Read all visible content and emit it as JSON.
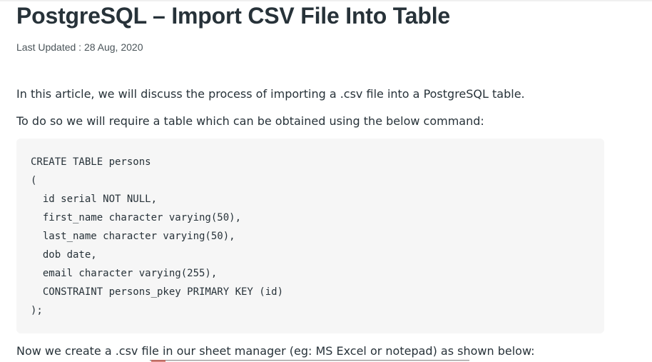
{
  "article": {
    "title": "PostgreSQL – Import CSV File Into Table",
    "last_updated": "Last Updated : 28 Aug, 2020",
    "intro": "In this article, we will discuss the process of importing a .csv file into a PostgreSQL table.",
    "setup": "To do so we will require a table which can be obtained using the below command:",
    "code": {
      "lines": [
        "CREATE TABLE persons",
        "(",
        "  id serial NOT NULL,",
        "  first_name character varying(50),",
        "  last_name character varying(50),",
        "  dob date,",
        "  email character varying(255),",
        "  CONSTRAINT persons_pkey PRIMARY KEY (id)",
        ");"
      ]
    },
    "next_step": "Now we create a .csv file in our sheet manager (eg: MS Excel or notepad) as shown below:"
  }
}
